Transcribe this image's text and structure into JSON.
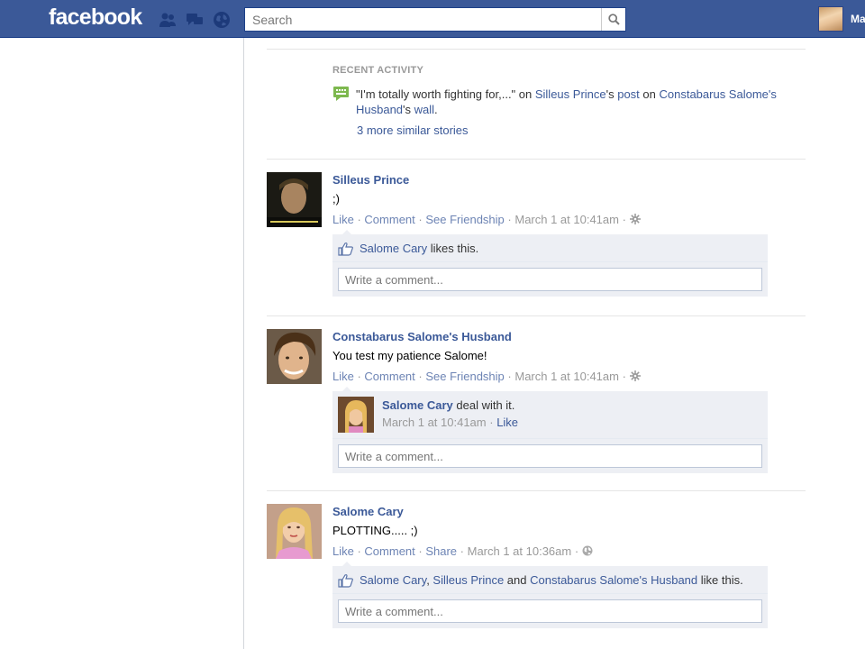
{
  "topbar": {
    "logo": "facebook",
    "search_placeholder": "Search",
    "profile_name": "Ma",
    "jewels": [
      "friend-requests-icon",
      "messages-icon",
      "notifications-globe-icon"
    ]
  },
  "recent_activity": {
    "title": "RECENT ACTIVITY",
    "quote": "\"I'm totally worth fighting for,...\"",
    "on1": " on ",
    "author": "Silleus Prince",
    "possessive1": "'s ",
    "post_link": "post",
    "on2": " on ",
    "owner": "Constabarus Salome's Husband",
    "possessive2": "'s ",
    "wall_link": "wall",
    "period": ".",
    "more_link": "3 more similar stories"
  },
  "stories": [
    {
      "author": "Silleus Prince",
      "message": ";)",
      "actions": {
        "like": "Like",
        "sep1": " · ",
        "comment": "Comment",
        "sep2": " · ",
        "third": "See Friendship",
        "sep3": " · ",
        "time": "March 1 at 10:41am",
        "sep4": " · "
      },
      "likes": {
        "name": "Salome Cary",
        "suffix": " likes this."
      },
      "comment_placeholder": "Write a comment..."
    },
    {
      "author": "Constabarus Salome's Husband",
      "message": "You test my patience Salome!",
      "actions": {
        "like": "Like",
        "sep1": " · ",
        "comment": "Comment",
        "sep2": " · ",
        "third": "See Friendship",
        "sep3": " · ",
        "time": "March 1 at 10:41am",
        "sep4": " · "
      },
      "comment": {
        "author": "Salome Cary",
        "text": " deal with it.",
        "time": "March 1 at 10:41am",
        "sep": " · ",
        "like": "Like"
      },
      "comment_placeholder": "Write a comment..."
    },
    {
      "author": "Salome Cary",
      "message": "PLOTTING..... ;)",
      "actions": {
        "like": "Like",
        "sep1": " · ",
        "comment": "Comment",
        "sep2": " · ",
        "third": "Share",
        "sep3": " · ",
        "time": "March 1 at 10:36am",
        "sep4": " · "
      },
      "likes": {
        "name1": "Salome Cary",
        "comma": ", ",
        "name2": "Silleus Prince",
        "and": " and ",
        "name3": "Constabarus Salome's Husband",
        "suffix": " like this."
      },
      "comment_placeholder": "Write a comment..."
    }
  ],
  "colors": {
    "brand": "#3b5998",
    "link": "#3b5998",
    "meta": "#999999",
    "ufi_bg": "#edeff4"
  }
}
